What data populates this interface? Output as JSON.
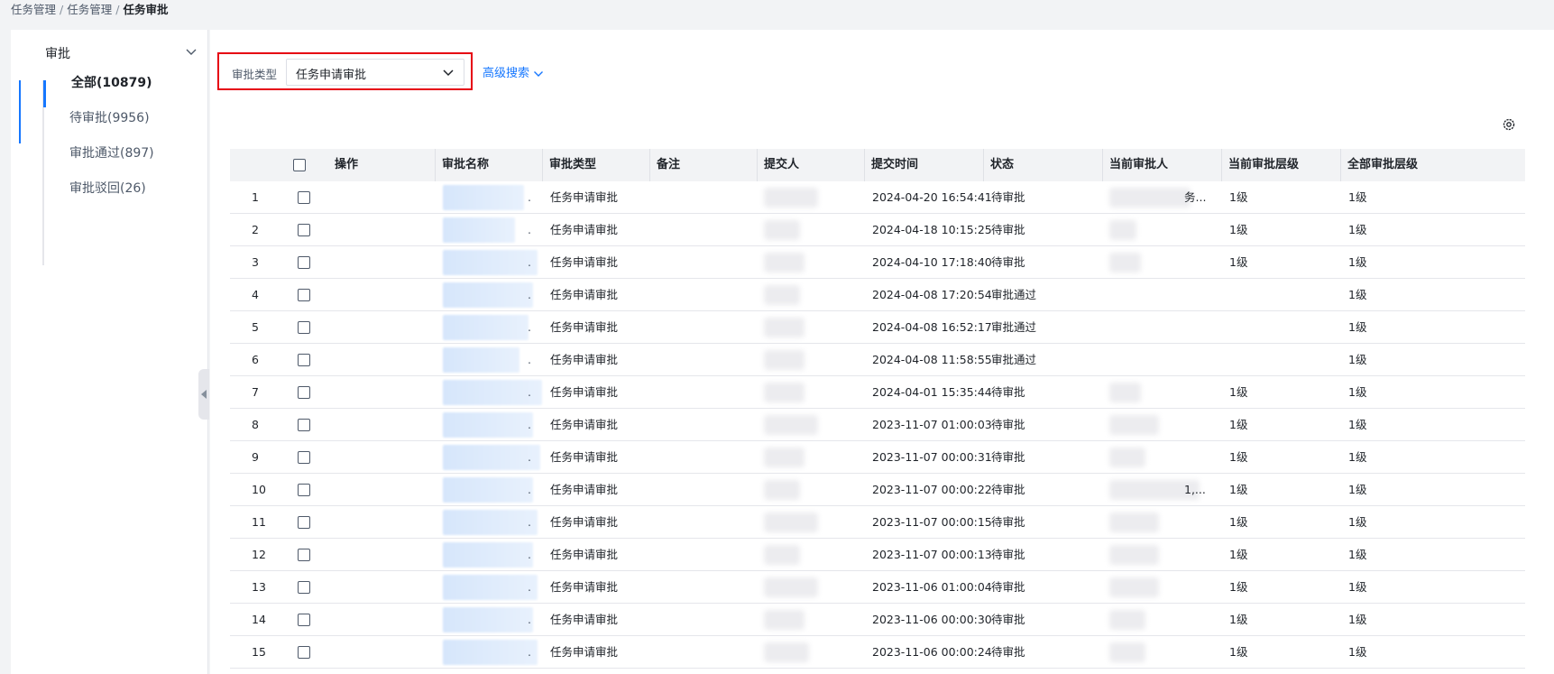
{
  "breadcrumb": {
    "items": [
      "任务管理",
      "任务管理"
    ],
    "current": "任务审批"
  },
  "sidebar": {
    "title": "审批",
    "items": [
      {
        "label": "全部(10879)",
        "active": true
      },
      {
        "label": "待审批(9956)",
        "active": false
      },
      {
        "label": "审批通过(897)",
        "active": false
      },
      {
        "label": "审批驳回(26)",
        "active": false
      }
    ]
  },
  "filter": {
    "label": "审批类型",
    "value": "任务申请审批"
  },
  "advanced_search": {
    "label": "高级搜索"
  },
  "table": {
    "headers": {
      "op": "操作",
      "name": "审批名称",
      "type": "审批类型",
      "note": "备注",
      "submitter": "提交人",
      "time": "提交时间",
      "status": "状态",
      "approver": "当前审批人",
      "level": "当前审批层级",
      "all_level": "全部审批层级"
    },
    "rows": [
      {
        "no": "1",
        "type": "任务申请审批",
        "time": "2024-04-20 16:54:41",
        "status": "待审批",
        "level": "1级",
        "all_level": "1级",
        "approver_tail": "务..."
      },
      {
        "no": "2",
        "type": "任务申请审批",
        "time": "2024-04-18 10:15:25",
        "status": "待审批",
        "level": "1级",
        "all_level": "1级",
        "approver_tail": ""
      },
      {
        "no": "3",
        "type": "任务申请审批",
        "time": "2024-04-10 17:18:40",
        "status": "待审批",
        "level": "1级",
        "all_level": "1级",
        "approver_tail": ""
      },
      {
        "no": "4",
        "type": "任务申请审批",
        "time": "2024-04-08 17:20:54",
        "status": "审批通过",
        "level": "",
        "all_level": "1级",
        "approver_tail": ""
      },
      {
        "no": "5",
        "type": "任务申请审批",
        "time": "2024-04-08 16:52:17",
        "status": "审批通过",
        "level": "",
        "all_level": "1级",
        "approver_tail": ""
      },
      {
        "no": "6",
        "type": "任务申请审批",
        "time": "2024-04-08 11:58:55",
        "status": "审批通过",
        "level": "",
        "all_level": "1级",
        "approver_tail": ""
      },
      {
        "no": "7",
        "type": "任务申请审批",
        "time": "2024-04-01 15:35:44",
        "status": "待审批",
        "level": "1级",
        "all_level": "1级",
        "approver_tail": ""
      },
      {
        "no": "8",
        "type": "任务申请审批",
        "time": "2023-11-07 01:00:03",
        "status": "待审批",
        "level": "1级",
        "all_level": "1级",
        "approver_tail": ""
      },
      {
        "no": "9",
        "type": "任务申请审批",
        "time": "2023-11-07 00:00:31",
        "status": "待审批",
        "level": "1级",
        "all_level": "1级",
        "approver_tail": ""
      },
      {
        "no": "10",
        "type": "任务申请审批",
        "time": "2023-11-07 00:00:22",
        "status": "待审批",
        "level": "1级",
        "all_level": "1级",
        "approver_tail": "1,..."
      },
      {
        "no": "11",
        "type": "任务申请审批",
        "time": "2023-11-07 00:00:15",
        "status": "待审批",
        "level": "1级",
        "all_level": "1级",
        "approver_tail": ""
      },
      {
        "no": "12",
        "type": "任务申请审批",
        "time": "2023-11-07 00:00:13",
        "status": "待审批",
        "level": "1级",
        "all_level": "1级",
        "approver_tail": ""
      },
      {
        "no": "13",
        "type": "任务申请审批",
        "time": "2023-11-06 01:00:04",
        "status": "待审批",
        "level": "1级",
        "all_level": "1级",
        "approver_tail": ""
      },
      {
        "no": "14",
        "type": "任务申请审批",
        "time": "2023-11-06 00:00:30",
        "status": "待审批",
        "level": "1级",
        "all_level": "1级",
        "approver_tail": ""
      },
      {
        "no": "15",
        "type": "任务申请审批",
        "time": "2023-11-06 00:00:24",
        "status": "待审批",
        "level": "1级",
        "all_level": "1级",
        "approver_tail": ""
      }
    ]
  },
  "icons": {
    "settings": "gear-icon",
    "sidebar_toggle": "chevron-down-icon",
    "select": "chevron-down-icon",
    "collapse": "caret-left-icon"
  },
  "colors": {
    "accent": "#1677ff",
    "highlight": "#e60012"
  }
}
